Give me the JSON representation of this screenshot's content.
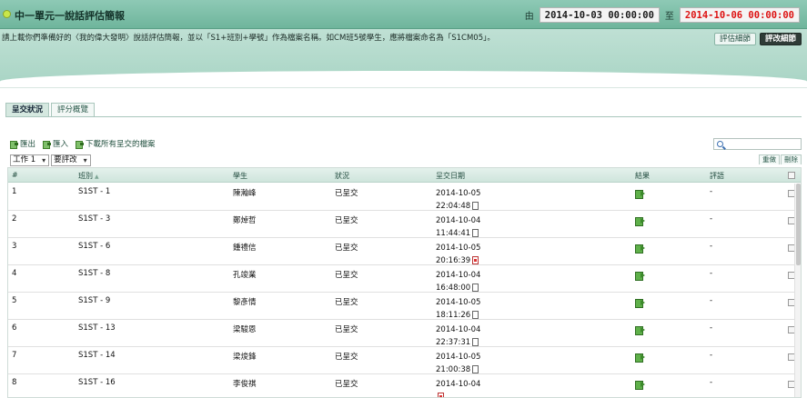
{
  "header": {
    "title": "中一單元一說話評估簡報",
    "from_label": "由",
    "start_date": "2014-10-03 00:00:00",
    "to_label": "至",
    "end_date": "2014-10-06 00:00:00"
  },
  "banner": {
    "instructions": "請上載你們準備好的〈我的偉大發明〉說話評估簡報，並以「S1+班別+學號」作為檔案名稱。如CM班5號學生，應將檔案命名為「S1CM05」。",
    "btn_criteria": "評估細節",
    "btn_marking": "評改細節"
  },
  "tabs": {
    "submission": "呈交狀況",
    "overview": "評分概覽"
  },
  "actions": {
    "export": "匯出",
    "import": "匯入",
    "download_all": "下載所有呈交的檔案"
  },
  "search": {
    "placeholder": ""
  },
  "filters": {
    "work": "工作 1",
    "status": "要評改"
  },
  "mini_tabs": {
    "redo": "重做",
    "delete": "刪除"
  },
  "columns": {
    "num": "#",
    "class": "班別",
    "student": "學生",
    "status": "狀況",
    "date": "呈交日期",
    "result": "結果",
    "comment": "評語"
  },
  "rows": [
    {
      "num": "1",
      "class": "S1ST - 1",
      "student": "陳瀚峰",
      "status": "已呈交",
      "date": "2014-10-05",
      "time": "22:04:48",
      "file": "doc",
      "comment": "-"
    },
    {
      "num": "2",
      "class": "S1ST - 3",
      "student": "鄭焯哲",
      "status": "已呈交",
      "date": "2014-10-04",
      "time": "11:44:41",
      "file": "doc",
      "comment": "-"
    },
    {
      "num": "3",
      "class": "S1ST - 6",
      "student": "鍾禮信",
      "status": "已呈交",
      "date": "2014-10-05",
      "time": "20:16:39",
      "file": "pdf",
      "comment": "-"
    },
    {
      "num": "4",
      "class": "S1ST - 8",
      "student": "孔竣業",
      "status": "已呈交",
      "date": "2014-10-04",
      "time": "16:48:00",
      "file": "doc",
      "comment": "-"
    },
    {
      "num": "5",
      "class": "S1ST - 9",
      "student": "黎彥情",
      "status": "已呈交",
      "date": "2014-10-05",
      "time": "18:11:26",
      "file": "doc",
      "comment": "-"
    },
    {
      "num": "6",
      "class": "S1ST - 13",
      "student": "梁駿恩",
      "status": "已呈交",
      "date": "2014-10-04",
      "time": "22:37:31",
      "file": "doc",
      "comment": "-"
    },
    {
      "num": "7",
      "class": "S1ST - 14",
      "student": "梁焌鋒",
      "status": "已呈交",
      "date": "2014-10-05",
      "time": "21:00:38",
      "file": "doc",
      "comment": "-"
    },
    {
      "num": "8",
      "class": "S1ST - 16",
      "student": "李俊祺",
      "status": "已呈交",
      "date": "2014-10-04",
      "time": "",
      "file": "pdf",
      "comment": "-"
    }
  ]
}
